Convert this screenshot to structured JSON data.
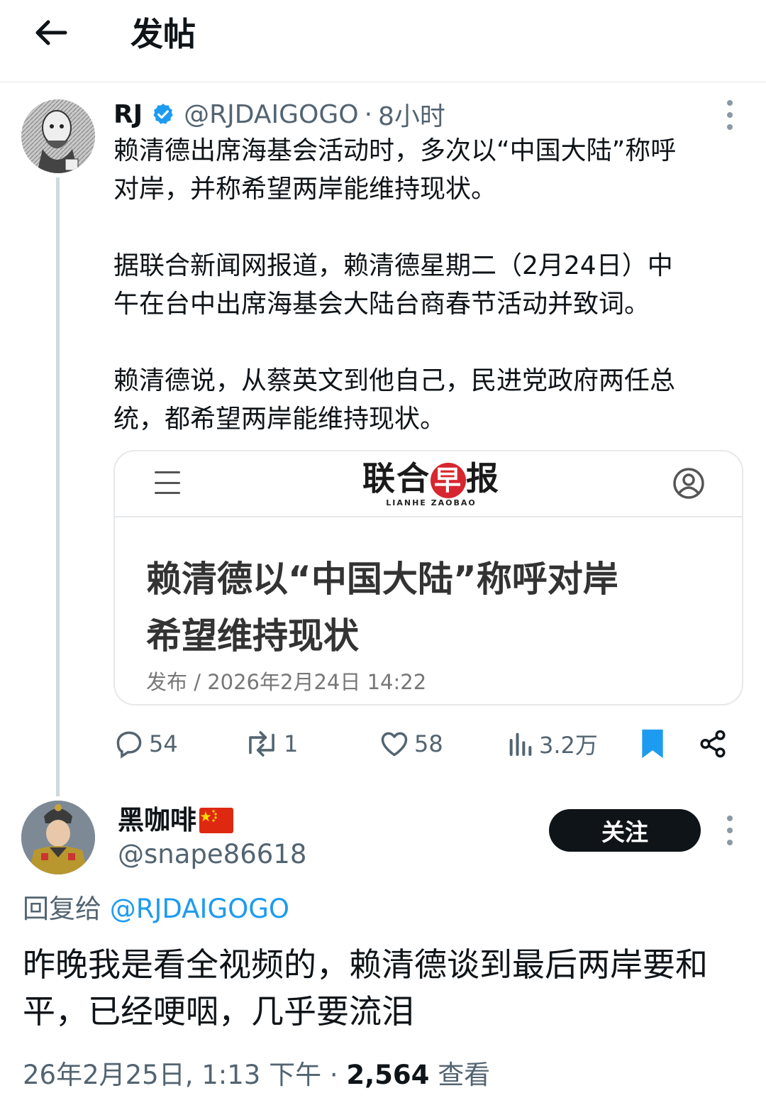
{
  "header": {
    "title": "发帖"
  },
  "post": {
    "author_name": "RJ",
    "handle": "@RJDAIGOGO",
    "separator": "·",
    "time": "8小时",
    "paragraphs": [
      "赖清德出席海基会活动时，多次以“中国大陆”称呼\n对岸，并称希望两岸能维持现状。",
      "据联合新闻网报道，赖清德星期二（2月24日）中\n午在台中出席海基会大陆台商春节活动并致词。",
      "赖清德说，从蔡英文到他自己，民进党政府两任总\n统，都希望两岸能维持现状。"
    ],
    "card": {
      "logo_part1": "联合",
      "logo_part2": "早",
      "logo_part3": "报",
      "logo_en": "LIANHE ZAOBAO",
      "headline": "赖清德以“中国大陆”称呼对岸\n希望维持现状",
      "published": "发布 / 2026年2月24日 14:22"
    },
    "stats": {
      "replies": "54",
      "reposts": "1",
      "likes": "58",
      "views": "3.2万"
    }
  },
  "reply": {
    "author_name": "黑咖啡",
    "handle": "@snape86618",
    "follow_label": "关注",
    "reply_prefix": "回复给",
    "reply_mention": "@RJDAIGOGO",
    "text": "昨晚我是看全视频的，赖清德谈到最后两岸要和\n平，已经哽咽，几乎要流泪",
    "timestamp": "26年2月25日, 1:13 下午 ·",
    "views_count": "2,564",
    "views_label": "查看"
  },
  "colors": {
    "accent": "#1d9bf0",
    "bookmark": "#1d9bf0",
    "text_primary": "#0f1419",
    "text_secondary": "#536471",
    "follow_bg": "#0f1419",
    "logo_red": "#d7262f"
  },
  "icons": {
    "back": "arrow-left-icon",
    "verified": "verified-badge-icon",
    "more": "more-vertical-icon",
    "reply": "speech-bubble-icon",
    "repost": "repost-icon",
    "like": "heart-icon",
    "views": "bar-chart-icon",
    "bookmark": "bookmark-icon",
    "share": "share-icon",
    "menu": "hamburger-menu-icon",
    "user": "user-circle-icon",
    "flag": "china-flag-icon"
  }
}
